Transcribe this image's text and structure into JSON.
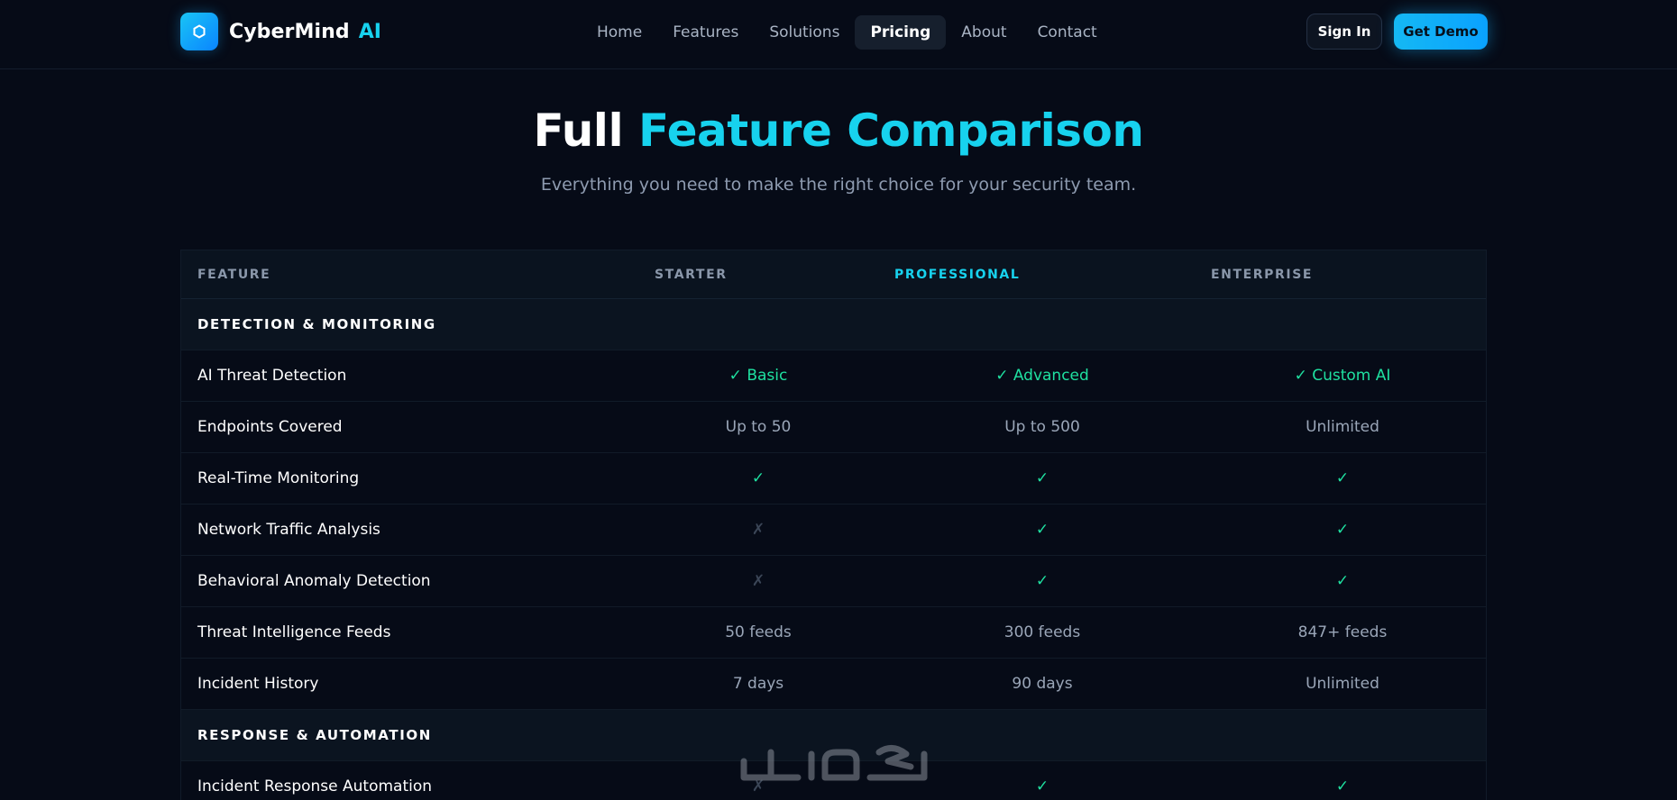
{
  "brand": {
    "name": "CyberMind",
    "suffix": "AI"
  },
  "nav": {
    "items": [
      {
        "label": "Home",
        "active": false
      },
      {
        "label": "Features",
        "active": false
      },
      {
        "label": "Solutions",
        "active": false
      },
      {
        "label": "Pricing",
        "active": true
      },
      {
        "label": "About",
        "active": false
      },
      {
        "label": "Contact",
        "active": false
      }
    ],
    "signin_label": "Sign In",
    "demo_label": "Get Demo"
  },
  "hero": {
    "title_plain": "Full",
    "title_accent": "Feature Comparison",
    "subtitle": "Everything you need to make the right choice for your security team."
  },
  "table": {
    "headers": [
      "FEATURE",
      "STARTER",
      "PROFESSIONAL",
      "ENTERPRISE"
    ],
    "sections": [
      {
        "label": "DETECTION & MONITORING",
        "rows": [
          {
            "feature": "AI Threat Detection",
            "starter": "✓ Basic",
            "professional": "✓ Advanced",
            "enterprise": "✓ Custom AI"
          },
          {
            "feature": "Endpoints Covered",
            "starter": "Up to 50",
            "professional": "Up to 500",
            "enterprise": "Unlimited"
          },
          {
            "feature": "Real-Time Monitoring",
            "starter": "✓",
            "professional": "✓",
            "enterprise": "✓"
          },
          {
            "feature": "Network Traffic Analysis",
            "starter": "✗",
            "professional": "✓",
            "enterprise": "✓"
          },
          {
            "feature": "Behavioral Anomaly Detection",
            "starter": "✗",
            "professional": "✓",
            "enterprise": "✓"
          },
          {
            "feature": "Threat Intelligence Feeds",
            "starter": "50 feeds",
            "professional": "300 feeds",
            "enterprise": "847+ feeds"
          },
          {
            "feature": "Incident History",
            "starter": "7 days",
            "professional": "90 days",
            "enterprise": "Unlimited"
          }
        ]
      },
      {
        "label": "RESPONSE & AUTOMATION",
        "rows": [
          {
            "feature": "Incident Response Automation",
            "starter": "✗",
            "professional": "✓",
            "enterprise": "✓"
          }
        ]
      }
    ]
  },
  "colors": {
    "accent": "#17d2ee",
    "check": "#1fe0a0",
    "cross": "#3b4657",
    "background": "#060b17"
  }
}
